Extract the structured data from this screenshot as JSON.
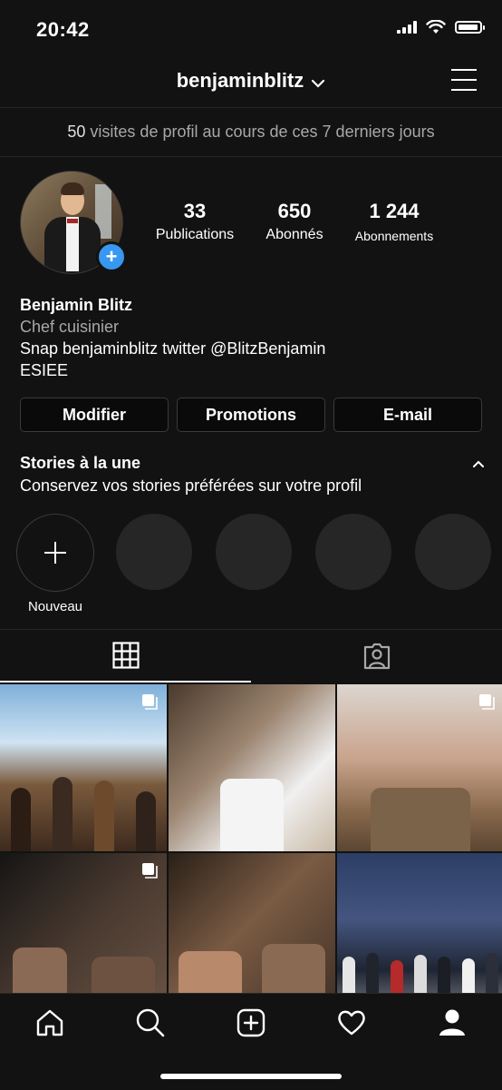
{
  "status": {
    "time": "20:42"
  },
  "header": {
    "username": "benjaminblitz"
  },
  "visits": {
    "count": "50",
    "text": "visites de profil au cours de ces 7 derniers jours"
  },
  "stats": [
    {
      "value": "33",
      "label": "Publications"
    },
    {
      "value": "650",
      "label": "Abonnés"
    },
    {
      "value": "1 244",
      "label": "Abonnements"
    }
  ],
  "bio": {
    "name": "Benjamin Blitz",
    "job": "Chef cuisinier",
    "line1": "Snap benjaminblitz twitter @BlitzBenjamin",
    "line2": "ESIEE"
  },
  "buttons": {
    "edit": "Modifier",
    "promotions": "Promotions",
    "email": "E-mail"
  },
  "highlights": {
    "title": "Stories à la une",
    "subtitle": "Conservez vos stories préférées sur votre profil",
    "new_label": "Nouveau"
  },
  "icons": {
    "chevron": "chevron-down-icon",
    "menu": "hamburger-menu-icon",
    "grid": "grid-icon",
    "tagged": "tagged-person-icon",
    "nav": [
      "home-icon",
      "search-icon",
      "add-post-icon",
      "heart-icon",
      "profile-icon"
    ]
  },
  "colors": {
    "background": "#121212",
    "accent": "#3897f0",
    "secondary_text": "#a8a8a8"
  }
}
